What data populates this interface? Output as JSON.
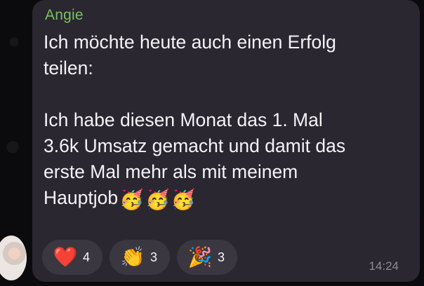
{
  "message": {
    "sender": "Angie",
    "text": "Ich möchte heute auch einen Erfolg\nteilen:\n\nIch habe diesen Monat das 1. Mal\n3.6k Umsatz gemacht und damit das\nerste Mal mehr als mit meinem\nHauptjob",
    "inline_emojis": [
      "🥳",
      "🥳",
      "🥳"
    ],
    "timestamp": "14:24"
  },
  "reactions": [
    {
      "emoji": "❤️",
      "icon": "red-heart-icon",
      "count": "4"
    },
    {
      "emoji": "👏",
      "icon": "clapping-hands-icon",
      "count": "3"
    },
    {
      "emoji": "🎉",
      "icon": "party-popper-icon",
      "count": "3"
    }
  ],
  "colors": {
    "bubble": "#2a2730",
    "sender": "#78c25a",
    "text": "#f4f3f6",
    "reaction_bg": "#3b3740",
    "timestamp": "#8f8a95"
  }
}
